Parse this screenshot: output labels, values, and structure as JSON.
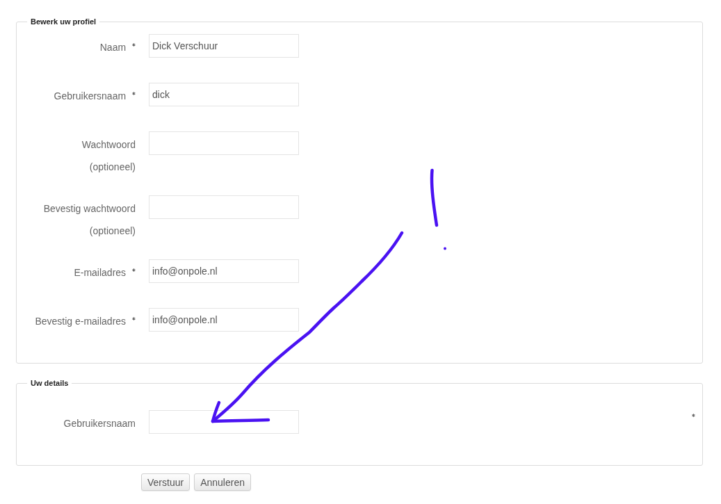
{
  "sections": [
    {
      "legend": "Bewerk uw profiel",
      "fields": [
        {
          "label": "Naam",
          "required": true,
          "value": "Dick Verschuur"
        },
        {
          "label": "Gebruikersnaam",
          "required": true,
          "value": "dick"
        },
        {
          "label": "Wachtwoord",
          "hint": "(optioneel)",
          "required": false
        },
        {
          "label": "Bevestig wachtwoord",
          "hint": "(optioneel)",
          "required": false
        },
        {
          "label": "E-mailadres",
          "required": true,
          "value": "info@onpole.nl"
        },
        {
          "label": "Bevestig e-mailadres",
          "required": true,
          "value": "info@onpole.nl"
        }
      ]
    },
    {
      "legend": "Uw details",
      "fields": [
        {
          "label": "Gebruikersnaam",
          "required": false,
          "stray_mark_at_row_end": true
        }
      ]
    }
  ],
  "buttons": [
    "Verstuur",
    "Annuleren"
  ],
  "hand_drawn": {
    "exclamation_mark": true,
    "arrow": true
  }
}
